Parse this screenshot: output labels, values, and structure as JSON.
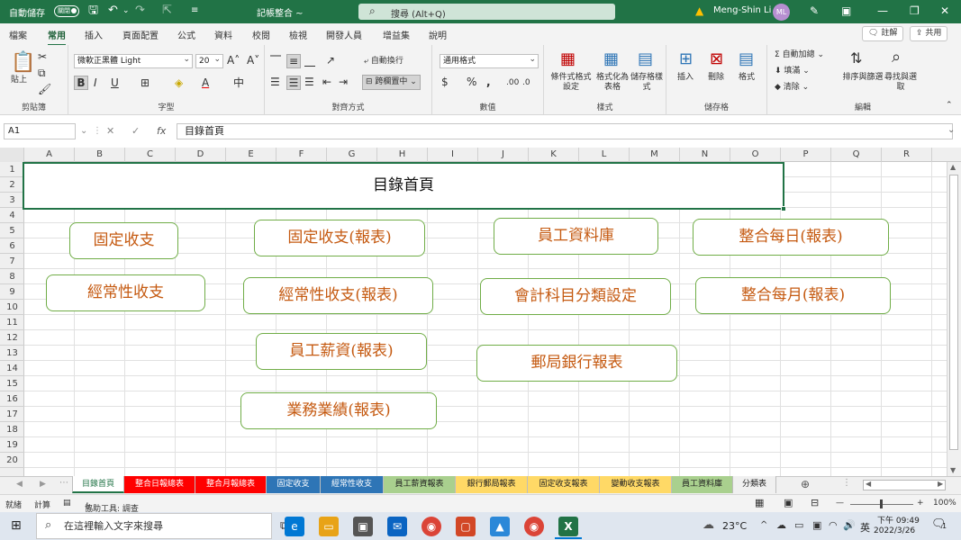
{
  "titlebar": {
    "autosave": "自動儲存",
    "autosave_state": "關閉",
    "doc_title": "記帳整合 ~",
    "search_placeholder": "搜尋 (Alt+Q)",
    "user_name": "Meng-Shin Li",
    "avatar_initials": "ML"
  },
  "tabs": [
    "檔案",
    "常用",
    "插入",
    "頁面配置",
    "公式",
    "資料",
    "校閱",
    "檢視",
    "開發人員",
    "增益集",
    "說明"
  ],
  "active_tab": "常用",
  "top_buttons": {
    "comments": "註解",
    "share": "共用"
  },
  "ribbon": {
    "clipboard": {
      "label": "剪貼簿",
      "paste": "貼上"
    },
    "font": {
      "label": "字型",
      "font_name": "微軟正黑體 Light",
      "font_size": "20"
    },
    "alignment": {
      "label": "對齊方式",
      "wrap": "自動換行",
      "merge": "跨欄置中"
    },
    "number": {
      "label": "數值",
      "format": "通用格式"
    },
    "styles": {
      "label": "樣式",
      "conditional": "條件式格式設定",
      "table": "格式化為表格",
      "cell": "儲存格樣式"
    },
    "cells": {
      "label": "儲存格",
      "insert": "插入",
      "delete": "刪除",
      "format": "格式"
    },
    "editing": {
      "label": "編輯",
      "autosum": "自動加總",
      "fill": "填滿",
      "clear": "清除",
      "sort": "排序與篩選",
      "find": "尋找與選取"
    }
  },
  "formula_bar": {
    "name_box": "A1",
    "formula": "目錄首頁"
  },
  "columns": [
    "A",
    "B",
    "C",
    "D",
    "E",
    "F",
    "G",
    "H",
    "I",
    "J",
    "K",
    "L",
    "M",
    "N",
    "O",
    "P",
    "Q",
    "R"
  ],
  "rows": [
    "1",
    "2",
    "3",
    "4",
    "5",
    "6",
    "7",
    "8",
    "9",
    "10",
    "11",
    "12",
    "13",
    "14",
    "15",
    "16",
    "17",
    "18",
    "19",
    "20"
  ],
  "title_cell": "目錄首頁",
  "nav_boxes": [
    "固定收支",
    "固定收支(報表)",
    "員工資料庫",
    "整合每日(報表)",
    "經常性收支",
    "經常性收支(報表)",
    "會計科目分類設定",
    "整合每月(報表)",
    "員工薪資(報表)",
    "郵局銀行報表",
    "業務業績(報表)"
  ],
  "sheet_tabs": [
    "目錄首頁",
    "整合日報總表",
    "整合月報總表",
    "固定收支",
    "經常性收支",
    "員工薪資報表",
    "銀行郵局報表",
    "固定收支報表",
    "變動收支報表",
    "員工資料庫",
    "分類表"
  ],
  "active_sheet": "目錄首頁",
  "colors": {
    "excel_green": "#217346",
    "tab_red": "#ff0000",
    "tab_blue": "#2e75b6",
    "tab_light_green": "#a9d08e",
    "tab_yellow": "#ffd966",
    "tab_green": "#70ad47",
    "nav_text": "#c55a11",
    "nav_border": "#70ad47"
  },
  "statusbar": {
    "mode": "就緒",
    "calc": "計算",
    "accessibility": "協助工具: 調查",
    "zoom": "100%"
  },
  "taskbar": {
    "search_placeholder": "在這裡輸入文字來搜尋",
    "temperature": "23°C",
    "lang": "英",
    "time": "下午 09:49",
    "date": "2022/3/26",
    "notifications": "1"
  }
}
